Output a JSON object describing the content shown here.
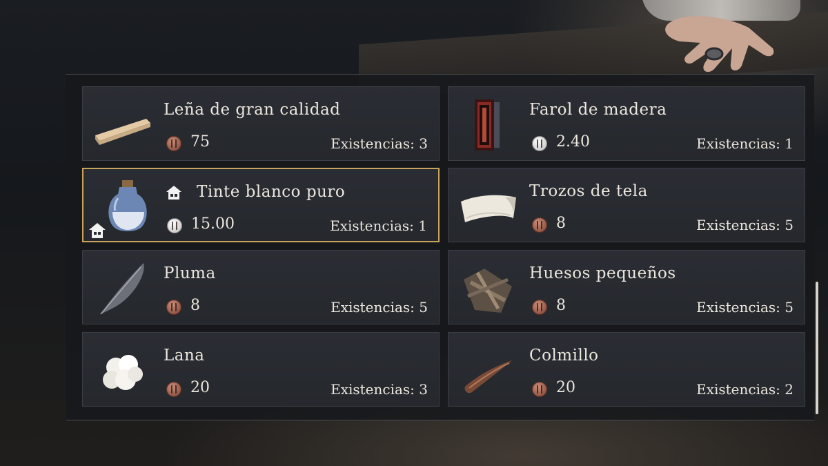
{
  "items": [
    {
      "name": "Leña de gran calidad",
      "price": "75",
      "stock": "Existencias: 3",
      "icon": "wood-plank-icon",
      "coin": "copper"
    },
    {
      "name": "Farol de madera",
      "price": "2.40",
      "stock": "Existencias: 1",
      "icon": "lantern-icon",
      "coin": "silver"
    },
    {
      "name": "Tinte blanco puro",
      "price": "15.00",
      "stock": "Existencias: 1",
      "icon": "dye-bottle-icon",
      "coin": "silver",
      "selected": true,
      "house_marked": true
    },
    {
      "name": "Trozos de tela",
      "price": "8",
      "stock": "Existencias: 5",
      "icon": "cloth-icon",
      "coin": "copper"
    },
    {
      "name": "Pluma",
      "price": "8",
      "stock": "Existencias: 5",
      "icon": "feather-icon",
      "coin": "copper"
    },
    {
      "name": "Huesos pequeños",
      "price": "8",
      "stock": "Existencias: 5",
      "icon": "bones-icon",
      "coin": "copper"
    },
    {
      "name": "Lana",
      "price": "20",
      "stock": "Existencias: 3",
      "icon": "wool-icon",
      "coin": "copper"
    },
    {
      "name": "Colmillo",
      "price": "20",
      "stock": "Existencias: 2",
      "icon": "fang-icon",
      "coin": "copper"
    }
  ],
  "colors": {
    "selected_border": "#c9a45a",
    "text": "#ece7de",
    "card_bg": "#2a2d33"
  }
}
